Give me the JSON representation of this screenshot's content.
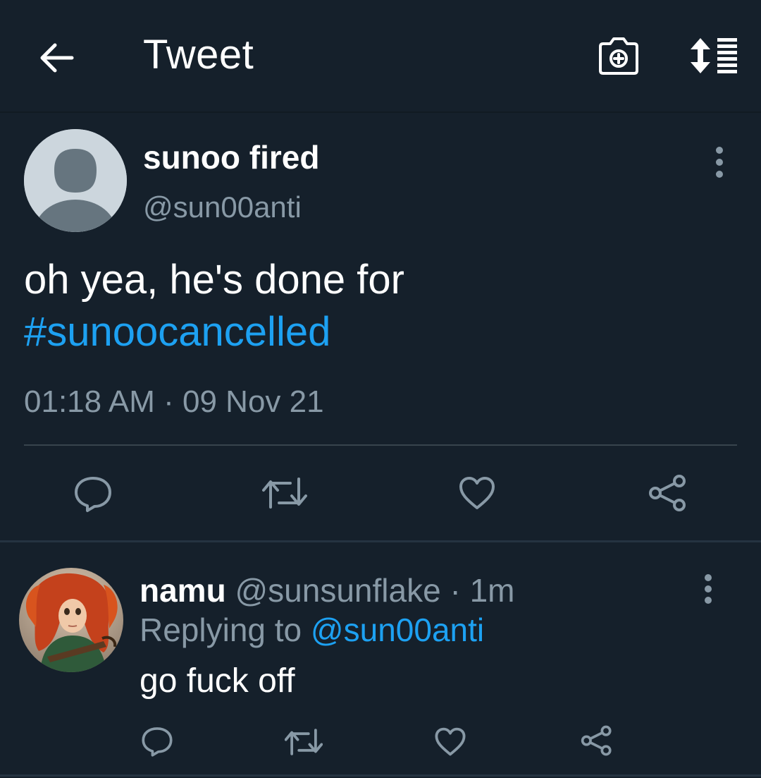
{
  "header": {
    "title": "Tweet",
    "back_icon": "arrow-left-icon",
    "camera_icon": "camera-plus-icon",
    "sort_icon": "sort-list-icon"
  },
  "tweet": {
    "author_name": "sunoo fired",
    "author_handle": "@sun00anti",
    "text": "oh yea, he's done for",
    "hashtag": "#sunoocancelled",
    "timestamp": "01:18 AM · 09 Nov 21",
    "actions": [
      "reply-icon",
      "retweet-icon",
      "like-icon",
      "share-icon"
    ]
  },
  "reply": {
    "author_name": "namu",
    "author_handle": "@sunsunflake",
    "separator": "·",
    "time_ago": "1m",
    "replying_label": "Replying to",
    "replying_handle": "@sun00anti",
    "text": "go fuck off",
    "actions": [
      "reply-icon",
      "retweet-icon",
      "like-icon",
      "share-icon"
    ]
  },
  "colors": {
    "background": "#15202b",
    "accent": "#1da1f2",
    "secondary_text": "#8899a6",
    "icon": "#8899a6"
  }
}
